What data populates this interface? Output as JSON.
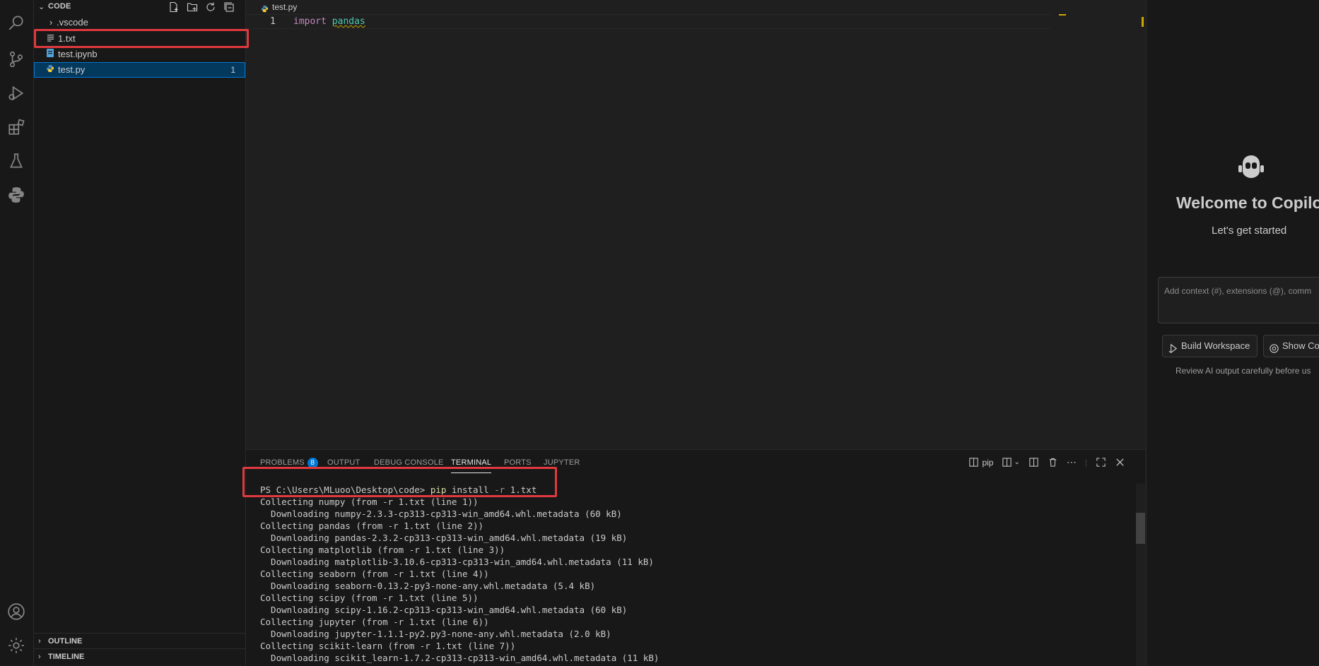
{
  "explorer": {
    "title": "CODE",
    "items": [
      {
        "label": ".vscode",
        "kind": "folder"
      },
      {
        "label": "1.txt",
        "kind": "text-file"
      },
      {
        "label": "test.ipynb",
        "kind": "notebook-file"
      },
      {
        "label": "test.py",
        "kind": "python-file",
        "problems": "1",
        "selected": true
      }
    ],
    "sections": [
      "OUTLINE",
      "TIMELINE"
    ]
  },
  "editor": {
    "tab_label": "test.py",
    "lines": [
      {
        "number": "1",
        "keyword": "import",
        "module": "pandas"
      }
    ]
  },
  "panel": {
    "tabs": {
      "problems": "PROBLEMS",
      "problems_count": "8",
      "output": "OUTPUT",
      "debug_console": "DEBUG CONSOLE",
      "terminal": "TERMINAL",
      "ports": "PORTS",
      "jupyter": "JUPYTER"
    },
    "active_tab": "TERMINAL",
    "terminal_name": "pip",
    "terminal": {
      "prompt": "PS C:\\Users\\MLuoo\\Desktop\\code> ",
      "cmd": "pip",
      "args1": " install ",
      "flag": "-r",
      "args2": " 1.txt",
      "output": [
        "Collecting numpy (from -r 1.txt (line 1))",
        "  Downloading numpy-2.3.3-cp313-cp313-win_amd64.whl.metadata (60 kB)",
        "Collecting pandas (from -r 1.txt (line 2))",
        "  Downloading pandas-2.3.2-cp313-cp313-win_amd64.whl.metadata (19 kB)",
        "Collecting matplotlib (from -r 1.txt (line 3))",
        "  Downloading matplotlib-3.10.6-cp313-cp313-win_amd64.whl.metadata (11 kB)",
        "Collecting seaborn (from -r 1.txt (line 4))",
        "  Downloading seaborn-0.13.2-py3-none-any.whl.metadata (5.4 kB)",
        "Collecting scipy (from -r 1.txt (line 5))",
        "  Downloading scipy-1.16.2-cp313-cp313-win_amd64.whl.metadata (60 kB)",
        "Collecting jupyter (from -r 1.txt (line 6))",
        "  Downloading jupyter-1.1.1-py2.py3-none-any.whl.metadata (2.0 kB)",
        "Collecting scikit-learn (from -r 1.txt (line 7))",
        "  Downloading scikit_learn-1.7.2-cp313-cp313-win_amd64.whl.metadata (11 kB)"
      ]
    }
  },
  "chat": {
    "welcome": "Welcome to Copilo",
    "subtitle": "Let's get started",
    "input_placeholder": "Add context (#), extensions (@), comm",
    "build_workspace": "Build Workspace",
    "show_co": "Show Co",
    "note": "Review AI output carefully before us"
  },
  "colors": {
    "accent": "#0078d4",
    "annotation_red": "#e0393e",
    "warning": "#cca700"
  }
}
